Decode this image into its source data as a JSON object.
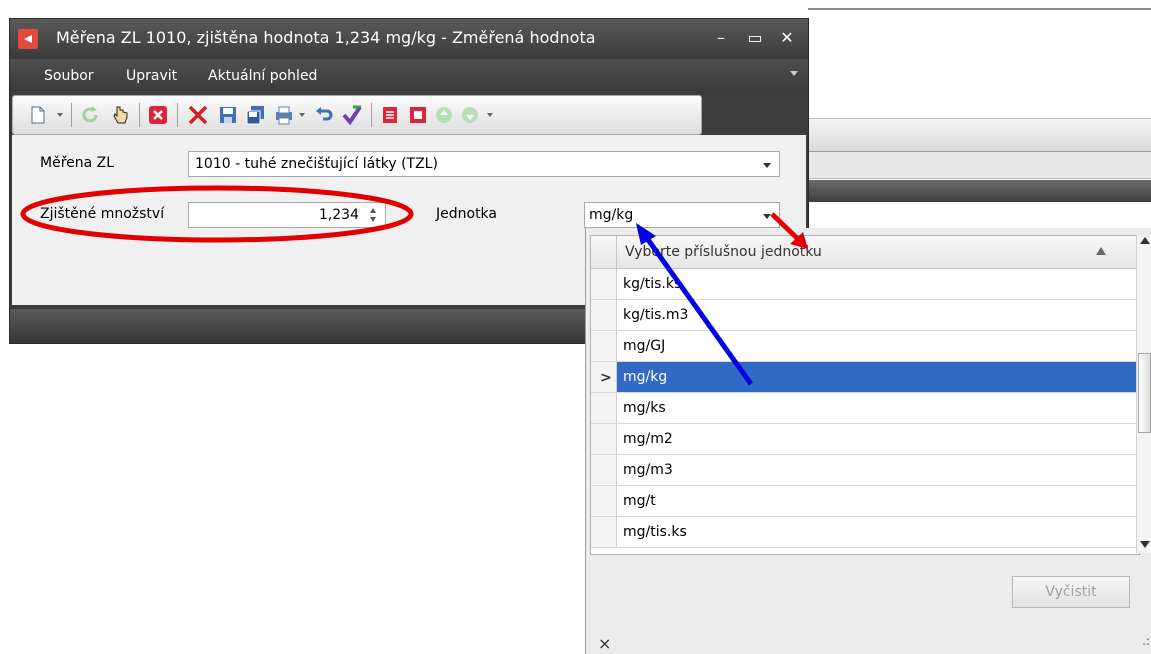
{
  "window": {
    "title": "Měřena ZL 1010, zjištěna hodnota 1,234 mg/kg - Změřená hodnota",
    "minimize_glyph": "–",
    "maximize_glyph": "▭",
    "close_glyph": "✕"
  },
  "menu": {
    "items": [
      "Soubor",
      "Upravit",
      "Aktuální pohled"
    ]
  },
  "toolbar": {
    "icons": [
      "new-document-icon",
      "refresh-icon",
      "hand-pointer-icon",
      "cancel-icon",
      "delete-icon",
      "save-icon",
      "save-all-icon",
      "print-icon",
      "undo-icon",
      "validate-check-icon",
      "report-icon",
      "export-icon",
      "move-up-icon",
      "move-down-icon"
    ]
  },
  "form": {
    "pollutant_label": "Měřena ZL",
    "pollutant_value": "1010 - tuhé znečišťující látky (TZL)",
    "quantity_label": "Zjištěné množství",
    "quantity_value": "1,234",
    "unit_label": "Jednotka",
    "unit_value": "mg/kg"
  },
  "dropdown": {
    "header": "Vyberte příslušnou jednotku",
    "rows": [
      "kg/tis.ks",
      "kg/tis.m3",
      "mg/GJ",
      "mg/kg",
      "mg/ks",
      "mg/m2",
      "mg/m3",
      "mg/t",
      "mg/tis.ks"
    ],
    "selected_index": 3,
    "row_pointer": ">",
    "clear_label": "Vyčistit",
    "close_glyph": "×",
    "grip_glyph": ".:"
  },
  "colors": {
    "selection": "#316ac5",
    "annotation_ellipse": "#e00000",
    "annotation_arrow_blue": "#0000e0",
    "annotation_arrow_red": "#e00000"
  }
}
